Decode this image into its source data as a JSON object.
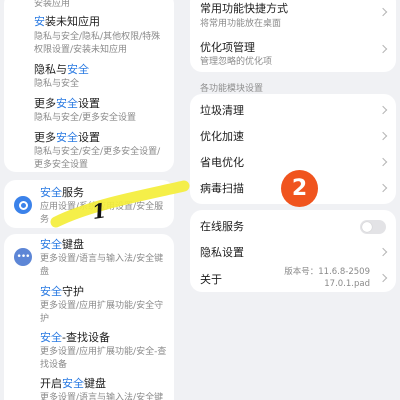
{
  "left_results": {
    "top_fragment": "安装应用",
    "items": [
      {
        "title_pre": "",
        "title_hl": "安",
        "title_post": "装未知应用",
        "desc": "隐私与安全/隐私/其他权限/特殊权限设置/安装未知应用",
        "desc_hl": "安"
      },
      {
        "title_pre": "隐私与",
        "title_hl": "安全",
        "title_post": "",
        "desc": "隐私与安全"
      },
      {
        "title_pre": "更多",
        "title_hl": "安全",
        "title_post": "设置",
        "desc": "隐私与安全/更多安全设置"
      },
      {
        "title_pre": "更多",
        "title_hl": "安全",
        "title_post": "设置",
        "desc": "隐私与安全/安全/更多安全设置/更多安全设置"
      }
    ]
  },
  "security_service": {
    "title_hl": "安全",
    "title_post": "服务",
    "desc": "应用设置/系统应用设置/安全服务",
    "annotation": "1"
  },
  "left_lower": [
    {
      "title_hl": "安全",
      "title_post": "键盘",
      "desc": "更多设置/语言与输入法/安全键盘",
      "icon": "keyboard-app-icon"
    },
    {
      "title_hl": "安全",
      "title_post": "守护",
      "desc": "更多设置/应用扩展功能/安全守护"
    },
    {
      "title_hl": "安全",
      "title_post": "-查找设备",
      "desc": "更多设置/应用扩展功能/安全-查找设备"
    },
    {
      "title_pre": "开启",
      "title_hl": "安全",
      "title_post": "键盘",
      "desc": "更多设置/语言与输入法/安全键"
    }
  ],
  "right_top": {
    "shortcut": {
      "label": "常用功能快捷方式",
      "sub": "将常用功能放在桌面"
    },
    "optimize": {
      "label": "优化项管理",
      "sub": "管理忽略的优化项"
    }
  },
  "modules": {
    "header": "各功能模块设置",
    "items": [
      "垃圾清理",
      "优化加速",
      "省电优化",
      "病毒扫描"
    ],
    "annotation": "2"
  },
  "bottom_card": {
    "online_service": "在线服务",
    "privacy": "隐私设置",
    "about": "关于",
    "version_line1": "版本号：11.6.8-2509",
    "version_line2": "17.0.1.pad"
  },
  "colors": {
    "accent": "#2a7ae2",
    "badge": "#f0541e",
    "highlighter": "#f4ee3a"
  }
}
